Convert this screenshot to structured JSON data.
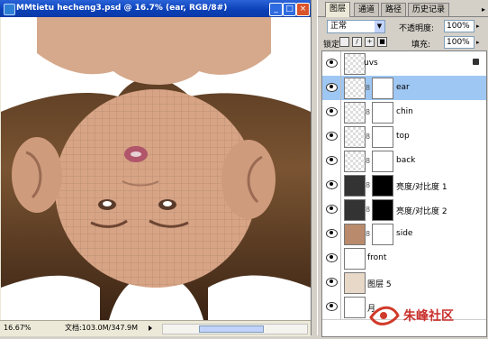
{
  "document": {
    "title": "MMtietu hecheng3.psd @ 16.7% (ear, RGB/8#)",
    "zoom": "16.67%",
    "doc_size": "文档:103.0M/347.9M"
  },
  "layers_panel": {
    "tabs": [
      "图层",
      "通道",
      "路径",
      "历史记录"
    ],
    "blend_mode": "正常",
    "opacity_label": "不透明度:",
    "opacity_value": "100%",
    "lock_label": "锁定:",
    "fill_label": "填充:",
    "fill_value": "100%",
    "layers": [
      {
        "name": "uvs",
        "selected": false
      },
      {
        "name": "ear",
        "selected": true
      },
      {
        "name": "chin",
        "selected": false
      },
      {
        "name": "top",
        "selected": false
      },
      {
        "name": "back",
        "selected": false
      },
      {
        "name": "亮度/对比度 1",
        "selected": false
      },
      {
        "name": "亮度/对比度 2",
        "selected": false
      },
      {
        "name": "side",
        "selected": false
      },
      {
        "name": "front",
        "selected": false
      },
      {
        "name": "图层 5",
        "selected": false
      },
      {
        "name": "月",
        "selected": false
      }
    ]
  },
  "watermark": "朱峰社区",
  "colors": {
    "selected_layer": "#9fc7f3",
    "titlebar": "#0a3fb6"
  }
}
